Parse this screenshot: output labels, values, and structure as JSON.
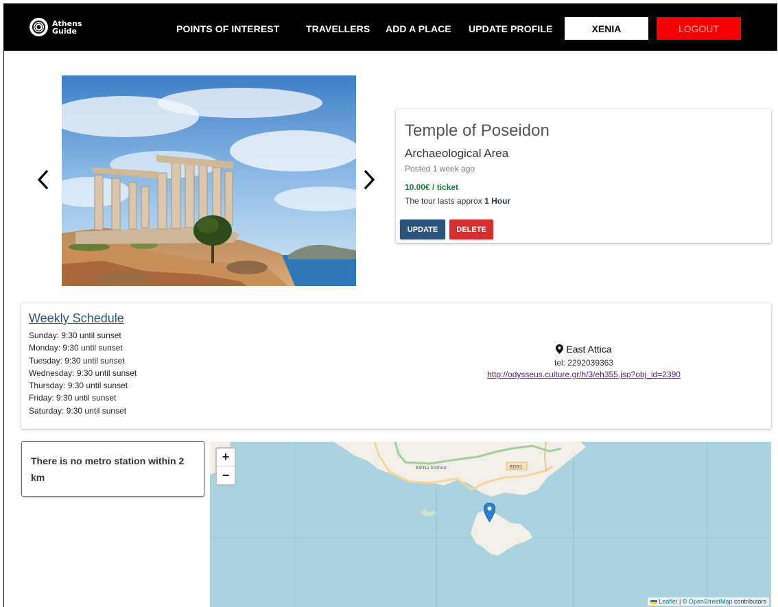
{
  "nav": {
    "brand_line1": "Athens",
    "brand_line2": "Guide",
    "links": [
      "POINTS OF INTEREST",
      "TRAVELLERS",
      "ADD A PLACE",
      "UPDATE PROFILE"
    ],
    "user_button": "XENIA",
    "logout_button": "LOGOUT"
  },
  "place": {
    "title": "Temple of Poseidon",
    "category": "Archaeological Area",
    "posted": "Posted 1 week ago",
    "price": "10.00€ / ticket",
    "tour_prefix": "The tour lasts approx",
    "tour_duration": "1 Hour",
    "update_label": "UPDATE",
    "delete_label": "DELETE"
  },
  "schedule": {
    "title": "Weekly Schedule",
    "days": [
      "Sunday: 9:30 until sunset",
      "Monday: 9:30 until sunset",
      "Tuesday: 9:30 until sunset",
      "Wednesday: 9:30 until sunset",
      "Thursday: 9:30 until sunset",
      "Friday: 9:30 until sunset",
      "Saturday: 9:30 until sunset"
    ]
  },
  "contact": {
    "location": "East Attica",
    "tel": "tel: 2292039363",
    "url": "http://odysseus.culture.gr/h/3/eh355.jsp?obj_id=2390"
  },
  "metro": {
    "message": "There is no metro station within 2 km"
  },
  "map": {
    "zoom_in": "+",
    "zoom_out": "−",
    "label_town": "Κάτω Σούνιο",
    "label_road": "ΕΟ91",
    "attribution_leaflet": "Leaflet",
    "attribution_sep": " | © ",
    "attribution_osm": "OpenStreetMap",
    "attribution_suffix": " contributors"
  },
  "colors": {
    "nav_bg": "#000000",
    "logout_bg": "#f70000",
    "update_bg": "#2c5379",
    "delete_bg": "#d32f2f",
    "price_green": "#1a7a35",
    "sea": "#aad3df"
  }
}
